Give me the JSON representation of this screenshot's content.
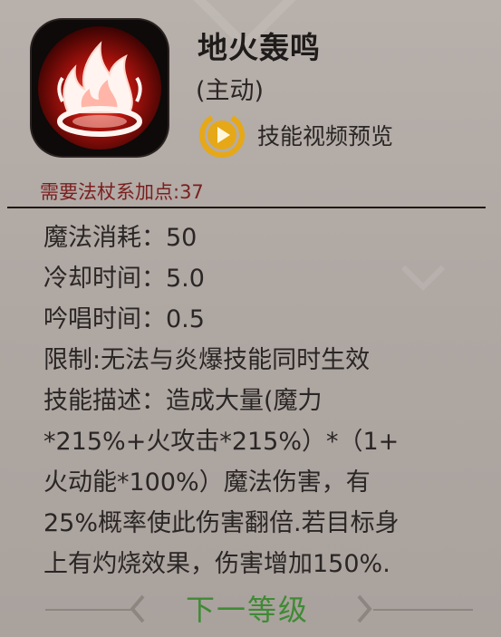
{
  "skill": {
    "icon": "fire-skill-icon",
    "name": "地火轰鸣",
    "type": "(主动)",
    "video_preview_label": "技能视频预览",
    "requirement": "需要法杖系加点:37"
  },
  "stats": [
    {
      "label": "魔法消耗：",
      "value": "50"
    },
    {
      "label": "冷却时间：",
      "value": "5.0"
    },
    {
      "label": "吟唱时间：",
      "value": "0.5"
    }
  ],
  "restriction": "限制:无法与炎爆技能同时生效",
  "description_lines": [
    "技能描述：造成大量(魔力",
    "*215%+火攻击*215%）*（1+",
    "火动能*100%）魔法伤害，有",
    "25%概率使此伤害翻倍.若目标身",
    "上有灼烧效果，伤害增加150%."
  ],
  "footer": {
    "next_level_label": "下一等级"
  },
  "colors": {
    "requirement": "#7a1f1f",
    "next_level": "#3f8a35",
    "play_icon": "#e6a817"
  }
}
